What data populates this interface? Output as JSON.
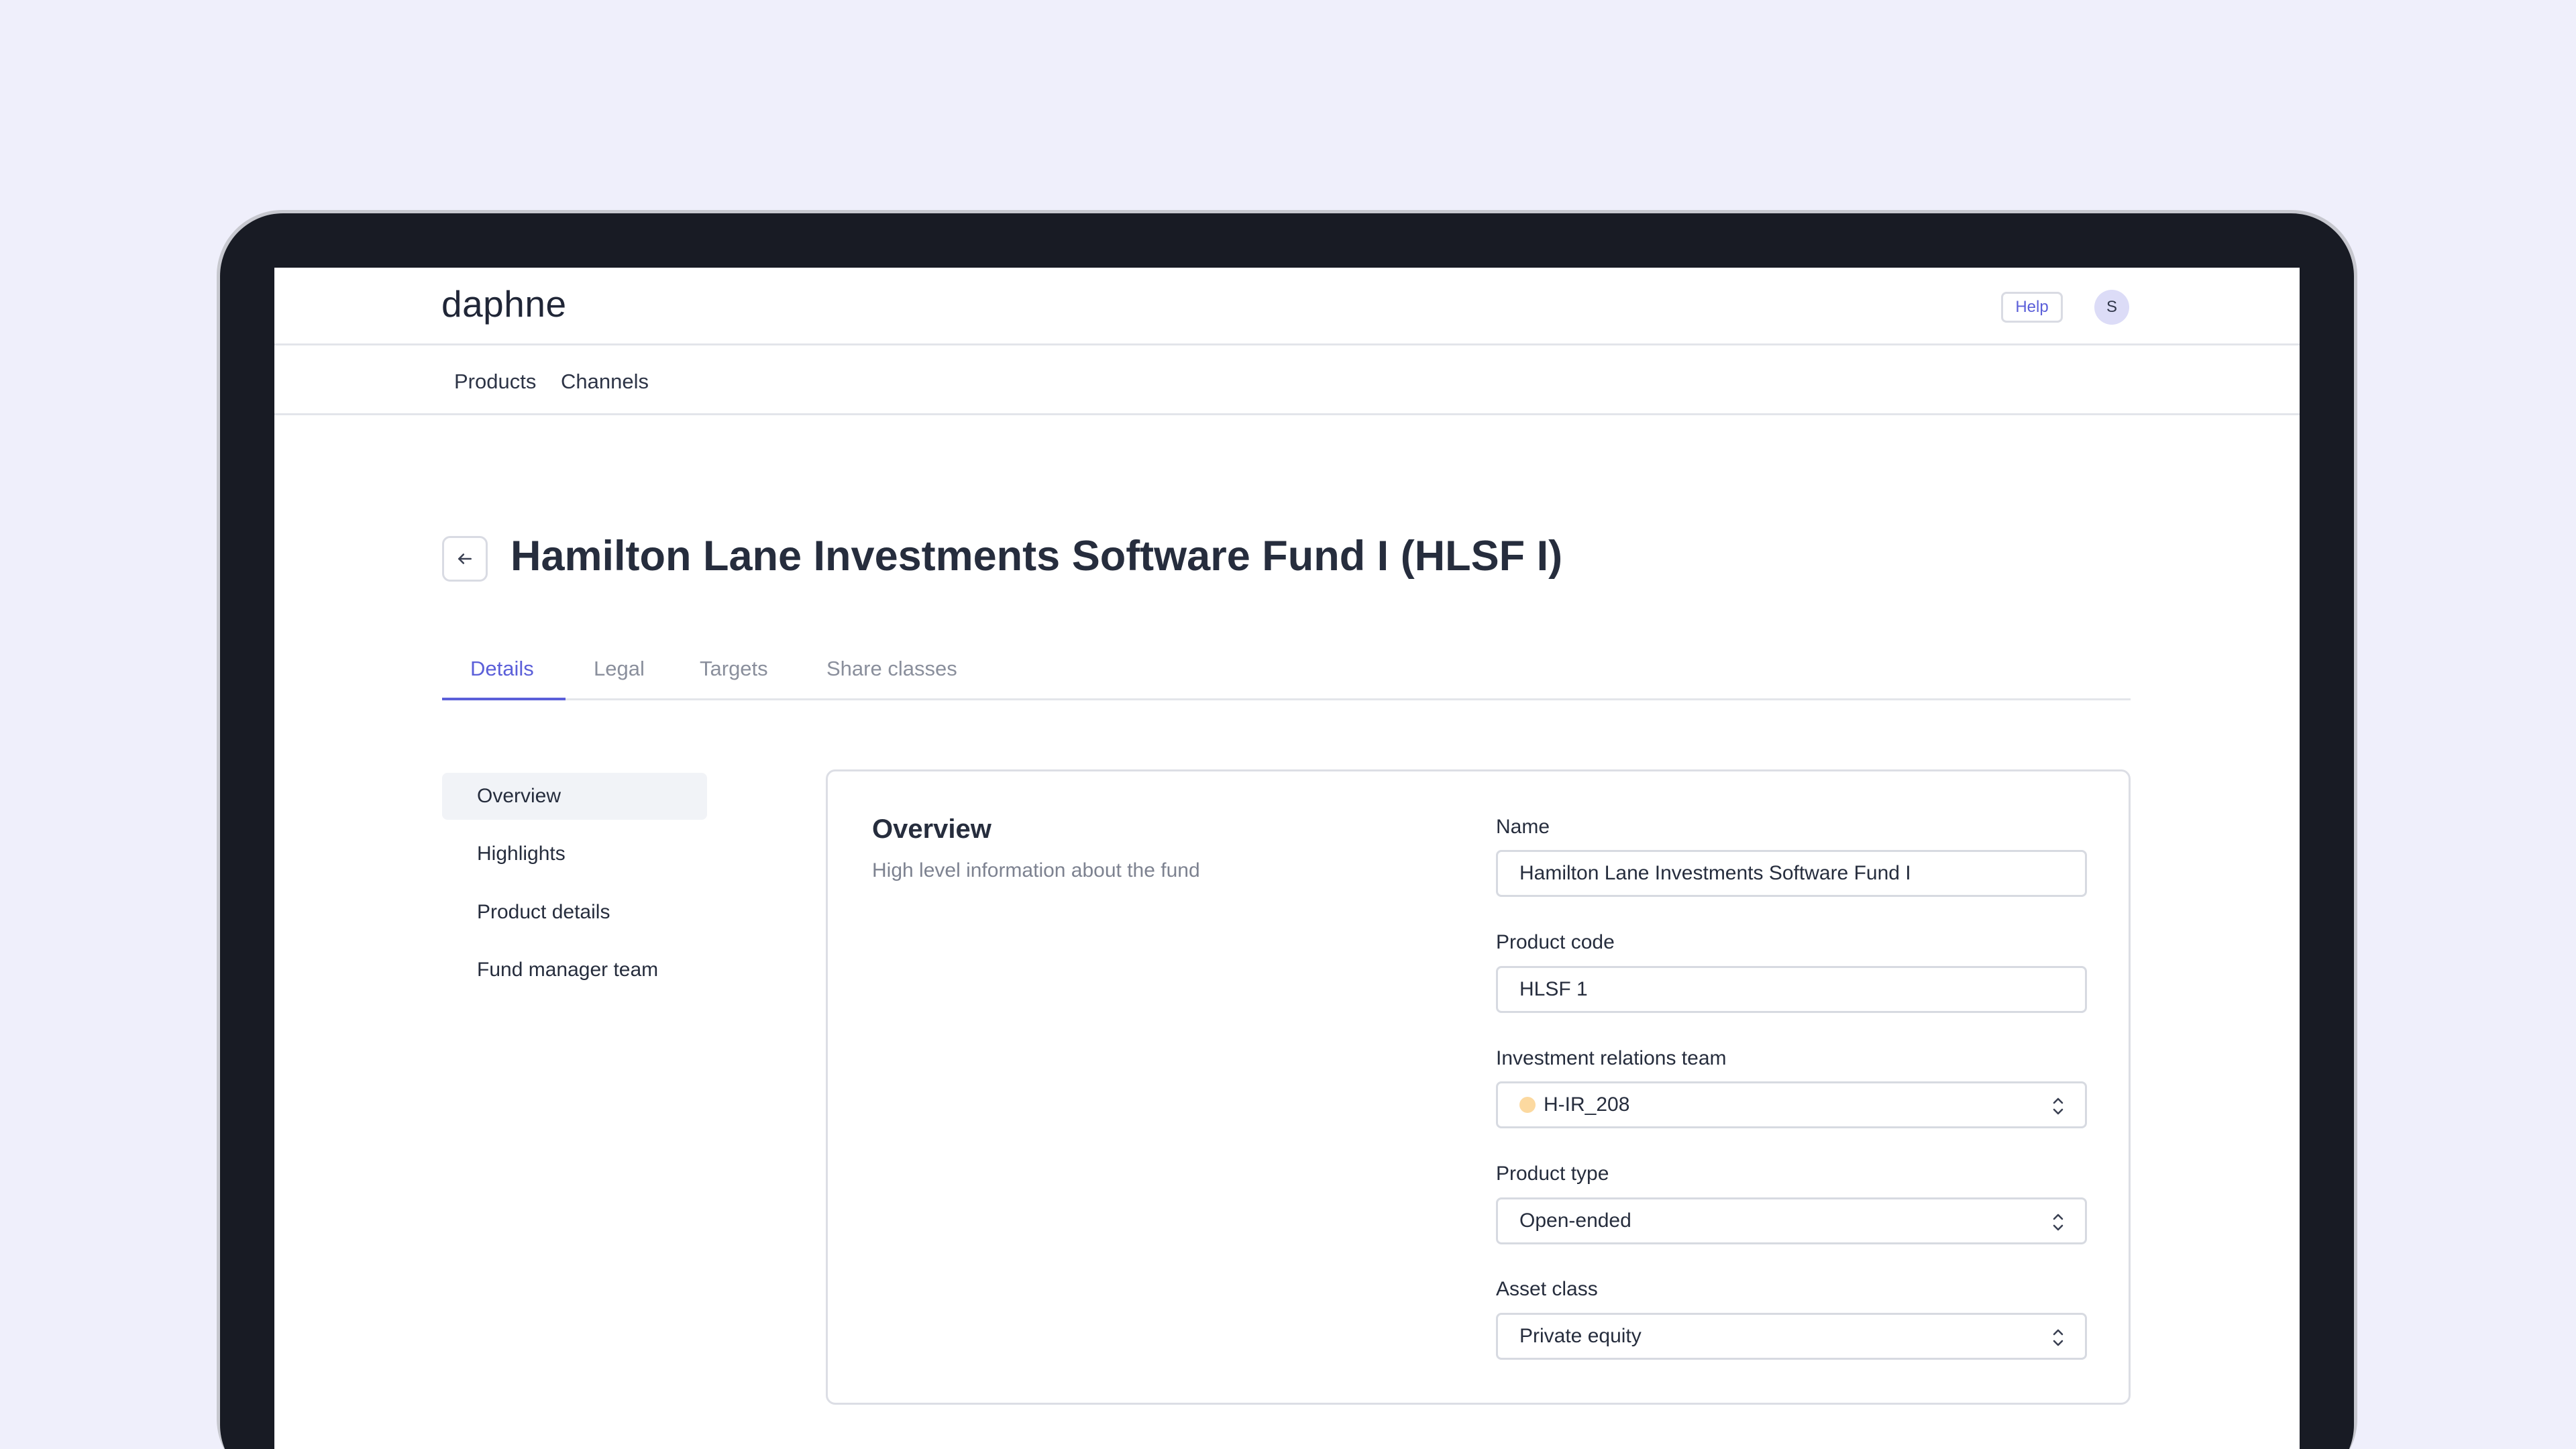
{
  "app": {
    "logo": "daphne",
    "help_label": "Help",
    "avatar_initial": "S"
  },
  "nav": {
    "products": "Products",
    "channels": "Channels"
  },
  "page": {
    "title": "Hamilton Lane Investments Software Fund I (HLSF I)"
  },
  "tabs": [
    {
      "label": "Details",
      "active": true
    },
    {
      "label": "Legal",
      "active": false
    },
    {
      "label": "Targets",
      "active": false
    },
    {
      "label": "Share classes",
      "active": false
    }
  ],
  "sidenav": [
    {
      "label": "Overview",
      "active": true
    },
    {
      "label": "Highlights",
      "active": false
    },
    {
      "label": "Product details",
      "active": false
    },
    {
      "label": "Fund manager team",
      "active": false
    }
  ],
  "overview": {
    "title": "Overview",
    "description": "High level information about the fund",
    "fields": {
      "name": {
        "label": "Name",
        "value": "Hamilton Lane Investments Software Fund I"
      },
      "product_code": {
        "label": "Product code",
        "value": "HLSF 1"
      },
      "ir_team": {
        "label": "Investment relations team",
        "value": "H-IR_208",
        "dot_color": "#fcd9a0"
      },
      "product_type": {
        "label": "Product type",
        "value": "Open-ended"
      },
      "asset_class": {
        "label": "Asset class",
        "value": "Private equity"
      }
    }
  },
  "colors": {
    "accent": "#5b5fd9",
    "background": "#efeffb",
    "device": "#181b24"
  },
  "icons": {
    "back": "arrow-left-icon",
    "select": "chevron-up-down-icon"
  }
}
